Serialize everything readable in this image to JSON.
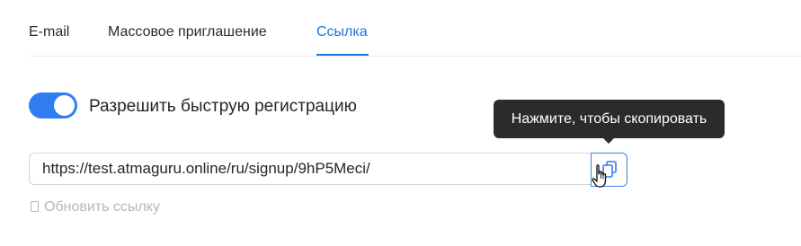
{
  "tabs": [
    {
      "label": "E-mail",
      "active": false
    },
    {
      "label": "Массовое приглашение",
      "active": false
    },
    {
      "label": "Ссылка",
      "active": true
    }
  ],
  "toggle": {
    "label": "Разрешить быструю регистрацию",
    "on": true
  },
  "link": {
    "value": "https://test.atmaguru.online/ru/signup/9hP5Meci/"
  },
  "tooltip": {
    "text": "Нажмите, чтобы скопировать"
  },
  "refresh": {
    "label": "Обновить ссылку"
  },
  "colors": {
    "accent": "#1f73e0",
    "toggle_on": "#2f7df0",
    "tooltip_bg": "#2b2b2b",
    "muted_text": "#b3b8bf"
  },
  "icons": {
    "copy": "copy-icon",
    "cursor": "hand-pointer-cursor-icon",
    "refresh": "refresh-icon"
  }
}
